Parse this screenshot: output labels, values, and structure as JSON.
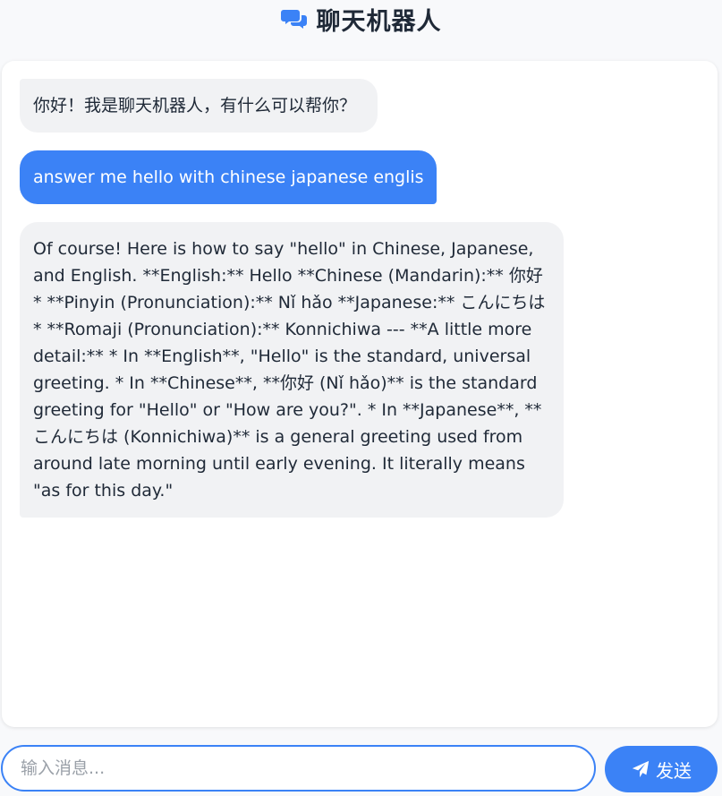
{
  "header": {
    "title": "聊天机器人",
    "icon": "comments-icon"
  },
  "colors": {
    "accent": "#3b82f6",
    "bot_bubble": "#f1f2f4",
    "page_bg": "#f8f9fb"
  },
  "messages": [
    {
      "role": "bot",
      "text": "你好！我是聊天机器人，有什么可以帮你？"
    },
    {
      "role": "user",
      "text": "answer me hello with chinese japanese englis"
    },
    {
      "role": "bot",
      "text": "Of course! Here is how to say \"hello\" in Chinese, Japanese, and English. **English:** Hello **Chinese (Mandarin):** 你好 * **Pinyin (Pronunciation):** Nǐ hǎo **Japanese:** こんにちは * **Romaji (Pronunciation):** Konnichiwa --- **A little more detail:** * In **English**, \"Hello\" is the standard, universal greeting. * In **Chinese**, **你好 (Nǐ hǎo)** is the standard greeting for \"Hello\" or \"How are you?\". * In **Japanese**, **こんにちは (Konnichiwa)** is a general greeting used from around late morning until early evening. It literally means \"as for this day.\""
    }
  ],
  "composer": {
    "placeholder": "输入消息...",
    "value": "",
    "send_label": "发送",
    "send_icon": "paper-plane-icon"
  }
}
